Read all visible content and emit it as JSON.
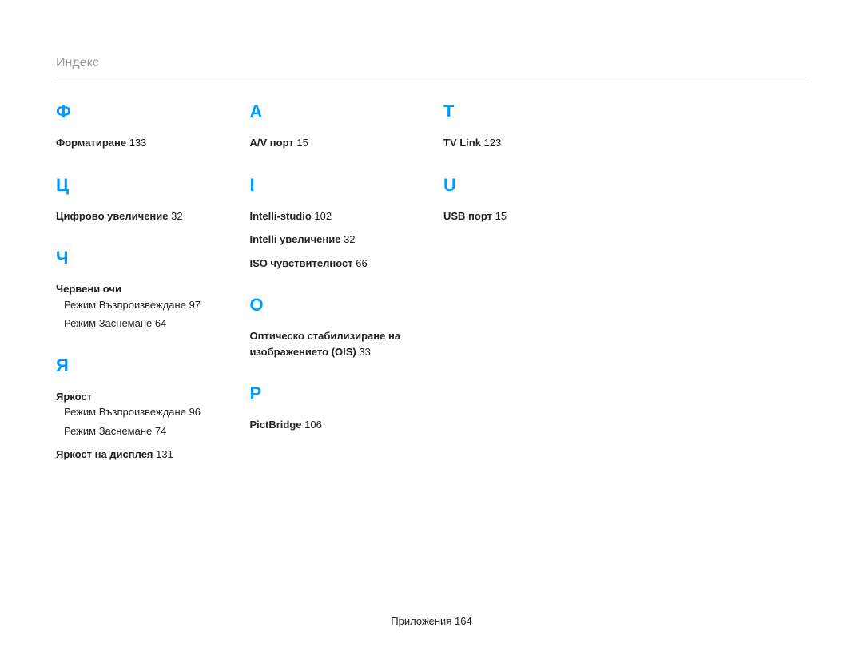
{
  "header": "Индекс",
  "columns": [
    {
      "sections": [
        {
          "letter": "Ф",
          "entries": [
            {
              "titleBold": "Форматиране",
              "page": "133"
            }
          ]
        },
        {
          "letter": "Ц",
          "entries": [
            {
              "titleBold": "Цифрово увеличение",
              "page": "32"
            }
          ]
        },
        {
          "letter": "Ч",
          "entries": [
            {
              "titleBold": "Червени очи",
              "subs": [
                {
                  "label": "Режим Възпроизвеждане",
                  "page": "97"
                },
                {
                  "label": "Режим Заснемане",
                  "page": "64"
                }
              ]
            }
          ]
        },
        {
          "letter": "Я",
          "entries": [
            {
              "titleBold": "Яркост",
              "subs": [
                {
                  "label": "Режим Възпроизвеждане",
                  "page": "96"
                },
                {
                  "label": "Режим Заснемане",
                  "page": "74"
                }
              ]
            },
            {
              "titleBold": "Яркост на дисплея",
              "page": "131"
            }
          ]
        }
      ]
    },
    {
      "sections": [
        {
          "letter": "A",
          "entries": [
            {
              "titleBold": "A/V порт",
              "page": "15"
            }
          ]
        },
        {
          "letter": "I",
          "entries": [
            {
              "titleBold": "Intelli-studio",
              "page": "102"
            },
            {
              "titleBold": "Intelli увеличение",
              "page": "32"
            },
            {
              "titleBold": "ISO чувствителност",
              "page": "66"
            }
          ]
        },
        {
          "letter": "O",
          "entries": [
            {
              "titleBold": "Оптическо стабилизиране на изображението (OIS)",
              "page": "33"
            }
          ]
        },
        {
          "letter": "P",
          "entries": [
            {
              "titleBold": "PictBridge",
              "page": "106"
            }
          ]
        }
      ]
    },
    {
      "sections": [
        {
          "letter": "T",
          "entries": [
            {
              "titleBold": "TV Link",
              "page": "123"
            }
          ]
        },
        {
          "letter": "U",
          "entries": [
            {
              "titleBold": "USB порт",
              "page": "15"
            }
          ]
        }
      ]
    }
  ],
  "footer": {
    "label": "Приложения",
    "page": "164"
  }
}
